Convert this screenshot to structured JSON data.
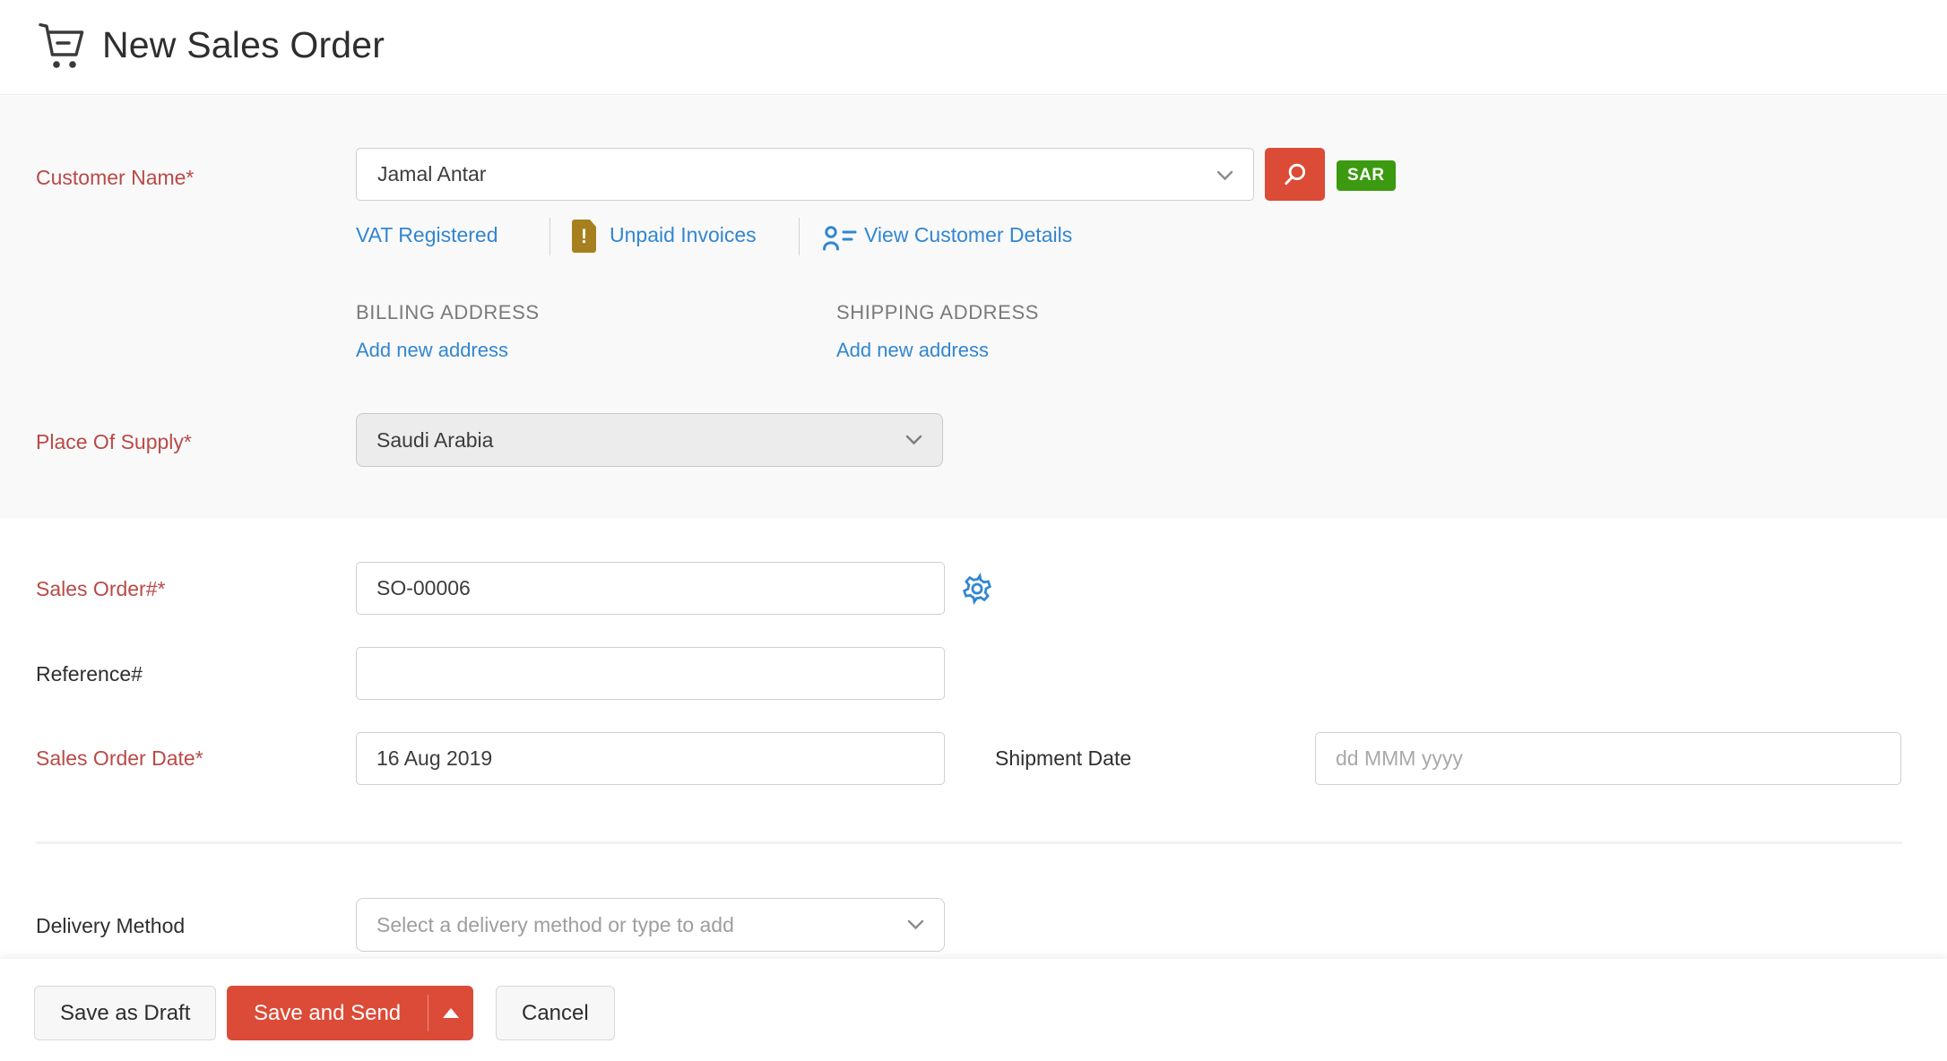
{
  "header": {
    "title": "New Sales Order"
  },
  "customer": {
    "label": "Customer Name*",
    "value": "Jamal Antar",
    "currency_badge": "SAR",
    "links": {
      "vat": "VAT Registered",
      "unpaid": "Unpaid Invoices",
      "view_details": "View Customer Details"
    },
    "billing": {
      "heading": "BILLING ADDRESS",
      "add_link": "Add new address"
    },
    "shipping": {
      "heading": "SHIPPING ADDRESS",
      "add_link": "Add new address"
    }
  },
  "place_of_supply": {
    "label": "Place Of Supply*",
    "value": "Saudi Arabia"
  },
  "sales_order_number": {
    "label": "Sales Order#*",
    "value": "SO-00006"
  },
  "reference": {
    "label": "Reference#",
    "value": ""
  },
  "sales_order_date": {
    "label": "Sales Order Date*",
    "value": "16 Aug 2019"
  },
  "shipment_date": {
    "label": "Shipment Date",
    "placeholder": "dd MMM yyyy"
  },
  "delivery_method": {
    "label": "Delivery Method",
    "placeholder": "Select a delivery method or type to add"
  },
  "footer": {
    "save_draft": "Save as Draft",
    "save_send": "Save and Send",
    "cancel": "Cancel"
  },
  "icons": {
    "header": "cart-icon",
    "customer_search": "search-icon",
    "dropdowns": "chevron-down-icon",
    "unpaid_warning": "warning-document-icon",
    "warning_glyph": "!",
    "view_customer": "contact-card-icon",
    "sales_order_settings": "gear-icon",
    "save_send_caret": "caret-up-icon"
  },
  "colors": {
    "accent_red": "#dc4b37",
    "link_blue": "#3286cf",
    "badge_green": "#3c9a10",
    "required_red": "#b94a47",
    "warning_gold": "#a6801f",
    "section_bg": "#f9f9fa"
  }
}
